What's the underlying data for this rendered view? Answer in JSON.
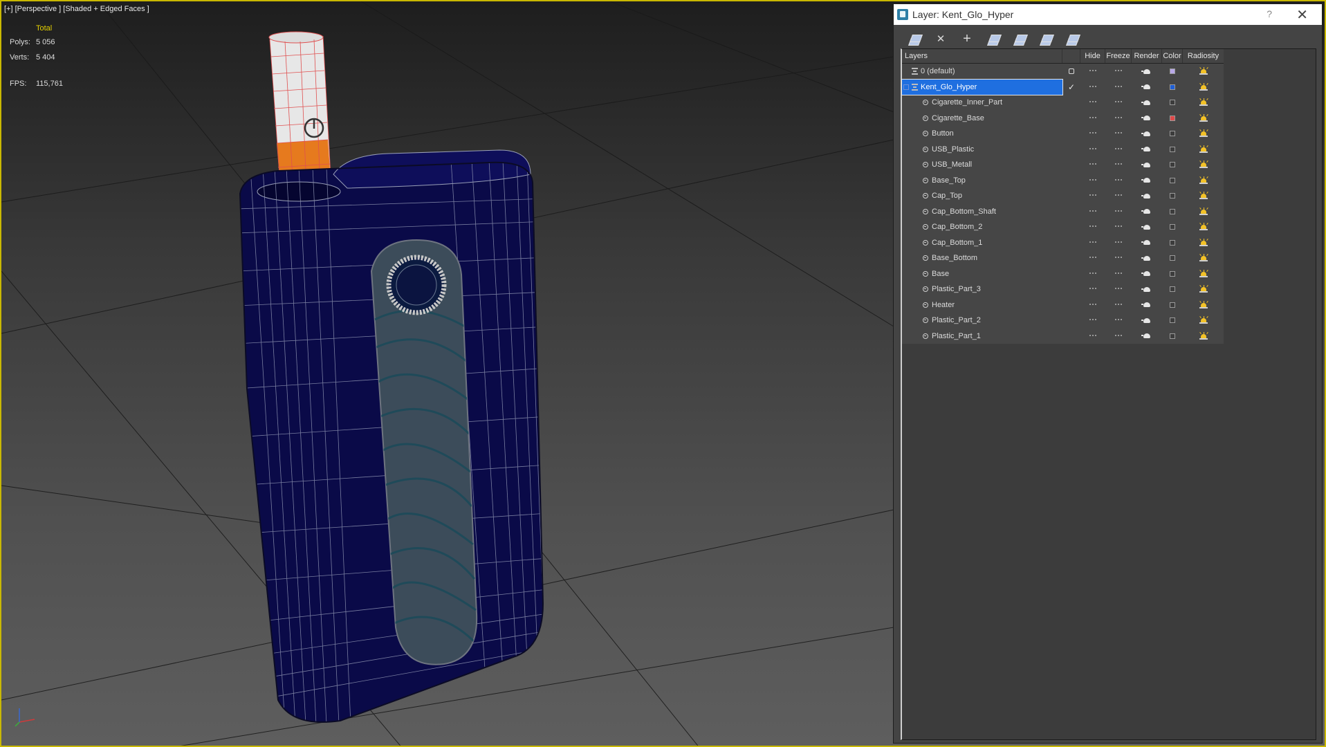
{
  "viewport": {
    "label": "[+] [Perspective ] [Shaded + Edged Faces ]",
    "stats": {
      "total_label": "Total",
      "polys_label": "Polys:",
      "polys_value": "5 056",
      "verts_label": "Verts:",
      "verts_value": "5 404",
      "fps_label": "FPS:",
      "fps_value": "115,761"
    },
    "colors": {
      "border": "#c9b800",
      "stats_text": "#e6d200",
      "wire": "#9aa0b8",
      "body": "#0c0c4a"
    }
  },
  "layer_window": {
    "title": "Layer: Kent_Glo_Hyper",
    "help_label": "?",
    "close_label": "✕",
    "toolbar": [
      {
        "name": "create-new-layer-icon"
      },
      {
        "name": "delete-layer-icon"
      },
      {
        "name": "add-to-layer-icon"
      },
      {
        "name": "select-objects-in-layer-icon"
      },
      {
        "name": "highlight-selected-layer-icon"
      },
      {
        "name": "hide-all-layers-icon"
      },
      {
        "name": "freeze-all-layers-icon"
      }
    ],
    "columns": {
      "layers": "Layers",
      "hide": "Hide",
      "freeze": "Freeze",
      "render": "Render",
      "color": "Color",
      "radiosity": "Radiosity"
    },
    "rows": [
      {
        "name": "0 (default)",
        "type": "layer",
        "color": "#b8a8e8",
        "current": "box"
      },
      {
        "name": "Kent_Glo_Hyper",
        "type": "layer",
        "color": "#1f5fd6",
        "current": "check",
        "selected": true
      },
      {
        "name": "Cigarette_Inner_Part",
        "type": "object",
        "color": "#3c3c3c"
      },
      {
        "name": "Cigarette_Base",
        "type": "object",
        "color": "#e04a4a"
      },
      {
        "name": "Button",
        "type": "object",
        "color": "#3c3c3c"
      },
      {
        "name": "USB_Plastic",
        "type": "object",
        "color": "#3c3c3c"
      },
      {
        "name": "USB_Metall",
        "type": "object",
        "color": "#3c3c3c"
      },
      {
        "name": "Base_Top",
        "type": "object",
        "color": "#3c3c3c"
      },
      {
        "name": "Cap_Top",
        "type": "object",
        "color": "#3c3c3c"
      },
      {
        "name": "Cap_Bottom_Shaft",
        "type": "object",
        "color": "#3c3c3c"
      },
      {
        "name": "Cap_Bottom_2",
        "type": "object",
        "color": "#3c3c3c"
      },
      {
        "name": "Cap_Bottom_1",
        "type": "object",
        "color": "#3c3c3c"
      },
      {
        "name": "Base_Bottom",
        "type": "object",
        "color": "#3c3c3c"
      },
      {
        "name": "Base",
        "type": "object",
        "color": "#3c3c3c"
      },
      {
        "name": "Plastic_Part_3",
        "type": "object",
        "color": "#3c3c3c"
      },
      {
        "name": "Heater",
        "type": "object",
        "color": "#3c3c3c"
      },
      {
        "name": "Plastic_Part_2",
        "type": "object",
        "color": "#3c3c3c"
      },
      {
        "name": "Plastic_Part_1",
        "type": "object",
        "color": "#3c3c3c"
      }
    ]
  }
}
